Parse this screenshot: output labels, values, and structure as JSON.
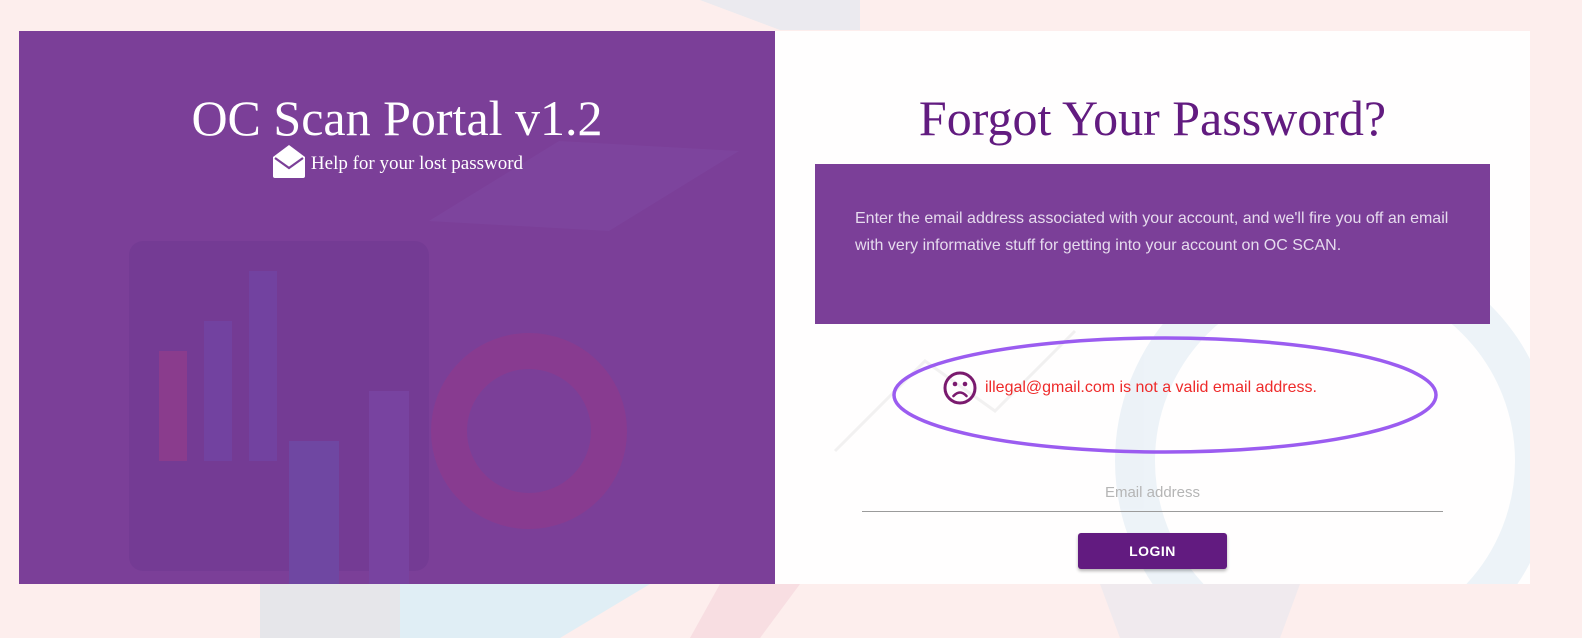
{
  "left_panel": {
    "title": "OC Scan Portal v1.2",
    "help_text": "Help for your lost password",
    "help_icon": "envelope-open-icon"
  },
  "right_panel": {
    "title": "Forgot Your Password?",
    "info_text": "Enter the email address associated with your account, and we'll fire you off an email with very informative stuff for getting into your account on OC SCAN.",
    "error": {
      "icon": "sad-face-icon",
      "text": "illegal@gmail.com is not a valid email address.",
      "highlighted": true
    },
    "email_field": {
      "value": "",
      "placeholder": "Email address"
    },
    "login_button_label": "LOGIN"
  },
  "colors": {
    "brand_purple": "#7b3f98",
    "dark_purple": "#621b80",
    "error_red": "#ee2a2a",
    "highlight_ring": "#9b5cf0",
    "page_background": "#fdeeed"
  }
}
